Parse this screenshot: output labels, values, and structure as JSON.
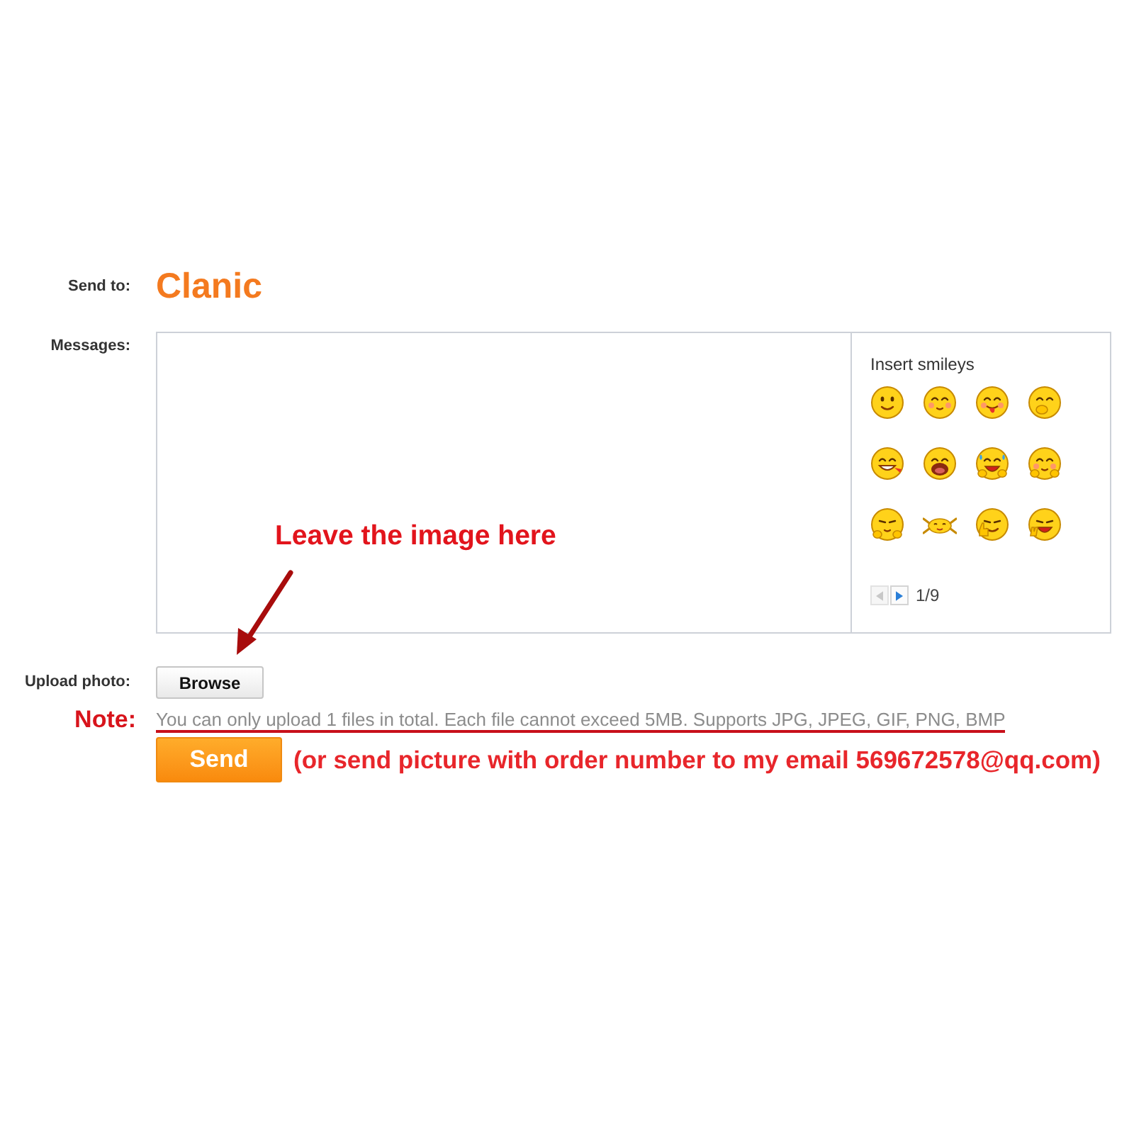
{
  "send_to": {
    "label": "Send to:",
    "value": "Clanic"
  },
  "messages": {
    "label": "Messages:"
  },
  "smileys": {
    "title": "Insert smileys",
    "page": "1/9",
    "prev_disabled": true,
    "next_disabled": false
  },
  "callout": "Leave the image here",
  "upload": {
    "label": "Upload photo:",
    "button": "Browse"
  },
  "note": {
    "label": "Note:",
    "hint": "You can only upload 1 files in total. Each file cannot exceed 5MB. Supports JPG, JPEG, GIF, PNG, BMP"
  },
  "send": {
    "button": "Send",
    "email_note": "(or send picture with order number to my email 569672578@qq.com)"
  }
}
